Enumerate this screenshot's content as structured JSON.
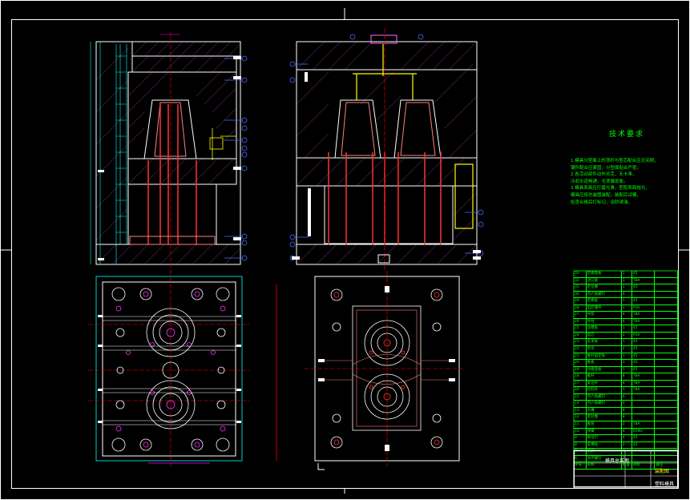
{
  "drawing": {
    "background": "#000000",
    "colors": {
      "frame": "#ffffff",
      "outline": "#ffffff",
      "hatch": "#ff66ff",
      "dimension": "#00ffff",
      "centerline": "#ff0000",
      "part": "#ff8080",
      "balloon": "#4a6cff",
      "text": "#00ff00",
      "highlight": "#ffff00"
    },
    "views": [
      "front-section-view",
      "side-section-view",
      "fixed-plate-plan-view",
      "moving-plate-plan-view"
    ]
  },
  "notes": {
    "title": "技术要求",
    "lines": [
      "1.模具分型面上的顶杆与型芯配合应无间隙，",
      "镶件配合应紧固，分型面贴合严密。",
      "2.各活动部件动作灵活，无卡滞，",
      "冷却水道畅通，无渗漏现象。",
      "3.模具表面应打磨光滑，型腔表面抛光，",
      "模具应按总装图装配，装配后试模，",
      "检查合格后打标记，涂防锈油。"
    ]
  },
  "bom": {
    "rows": [
      [
        "33",
        "定模座板",
        "1",
        "45",
        ""
      ],
      [
        "32",
        "浇口套",
        "1",
        "T8A",
        ""
      ],
      [
        "31",
        "定位圈",
        "1",
        "45",
        ""
      ],
      [
        "30",
        "内六角螺钉",
        "4",
        "",
        ""
      ],
      [
        "29",
        "定模板",
        "1",
        "45",
        ""
      ],
      [
        "28",
        "型腔镶件",
        "2",
        "P20",
        ""
      ],
      [
        "27",
        "导套",
        "4",
        "T8A",
        ""
      ],
      [
        "26",
        "导柱",
        "4",
        "T8A",
        ""
      ],
      [
        "25",
        "动模板",
        "1",
        "45",
        ""
      ],
      [
        "24",
        "型芯",
        "2",
        "P20",
        ""
      ],
      [
        "23",
        "支承板",
        "1",
        "45",
        ""
      ],
      [
        "22",
        "垫块",
        "2",
        "45",
        ""
      ],
      [
        "21",
        "推杆固定板",
        "1",
        "45",
        ""
      ],
      [
        "20",
        "推板",
        "1",
        "45",
        ""
      ],
      [
        "19",
        "动模座板",
        "1",
        "45",
        ""
      ],
      [
        "18",
        "推杆",
        "8",
        "T8A",
        ""
      ],
      [
        "17",
        "复位杆",
        "4",
        "T8A",
        ""
      ],
      [
        "16",
        "拉料杆",
        "1",
        "T8A",
        ""
      ],
      [
        "15",
        "内六角螺钉",
        "6",
        "",
        ""
      ],
      [
        "14",
        "内六角螺钉",
        "4",
        "",
        ""
      ],
      [
        "13",
        "水嘴",
        "8",
        "",
        ""
      ],
      [
        "12",
        "密封圈",
        "8",
        "",
        ""
      ],
      [
        "11",
        "推管",
        "2",
        "T8A",
        ""
      ],
      [
        "10",
        "弹簧",
        "4",
        "65Mn",
        ""
      ],
      [
        "9",
        "限位钉",
        "4",
        "45",
        ""
      ],
      [
        "8",
        "支撑柱",
        "2",
        "45",
        ""
      ],
      [
        "7",
        "销钉",
        "4",
        "",
        ""
      ],
      [
        "6",
        "吊环螺钉",
        "2",
        "",
        ""
      ]
    ],
    "footer": [
      "序号",
      "名称",
      "数量",
      "材料",
      "备注"
    ]
  },
  "title_block": {
    "name": "模具总装图",
    "label": "装配图",
    "label2": "塑料模具"
  }
}
